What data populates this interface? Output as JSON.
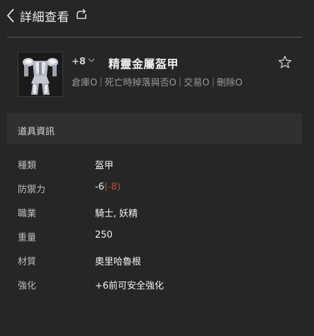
{
  "header": {
    "title": "詳細查看",
    "back_icon": "chevron-left-icon",
    "share_icon": "share-icon"
  },
  "item": {
    "enchant": "+8",
    "name": "精靈金屬盔甲",
    "thumbnail_icon": "armor-icon",
    "attributes": [
      "倉庫O",
      "死亡時掉落與否O",
      "交易O",
      "刪除O"
    ]
  },
  "section": {
    "title": "道具資訊"
  },
  "details": [
    {
      "key": "種類",
      "value": "盔甲"
    },
    {
      "key": "防禦力",
      "value": "-6",
      "modifier": "(-8)"
    },
    {
      "key": "職業",
      "value": "騎士, 妖精"
    },
    {
      "key": "重量",
      "value": "250"
    },
    {
      "key": "材質",
      "value": "奧里哈魯根"
    },
    {
      "key": "強化",
      "value": "+6前可安全強化"
    }
  ],
  "colors": {
    "background": "#262626",
    "section_bar": "#303030",
    "modifier_red": "#c04e3a"
  }
}
